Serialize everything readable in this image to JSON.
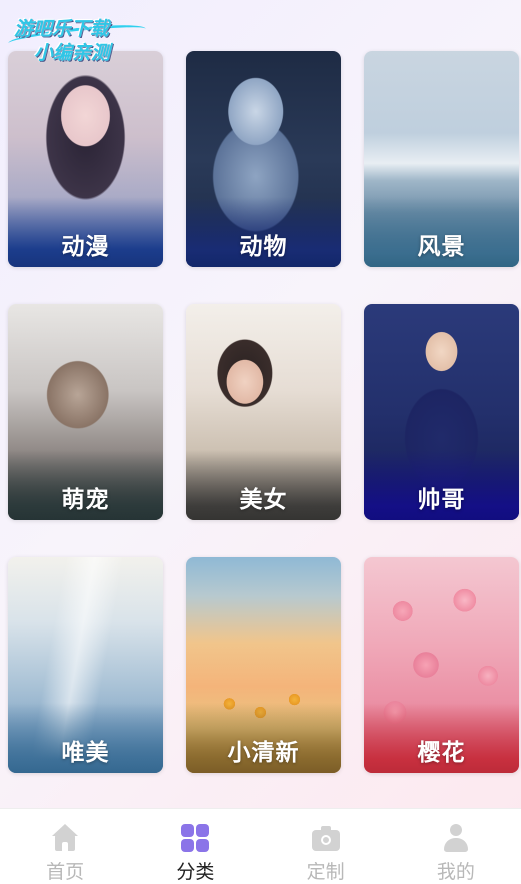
{
  "watermark": {
    "line1": "游吧乐下载",
    "line2": "小编亲测"
  },
  "categories": [
    {
      "label": "动漫",
      "icon": "anime-girl-image"
    },
    {
      "label": "动物",
      "icon": "white-fox-image"
    },
    {
      "label": "风景",
      "icon": "snow-mountain-lake-image"
    },
    {
      "label": "萌宠",
      "icon": "siamese-cat-image"
    },
    {
      "label": "美女",
      "icon": "girl-portrait-image"
    },
    {
      "label": "帅哥",
      "icon": "boy-portrait-image"
    },
    {
      "label": "唯美",
      "icon": "frozen-trees-image"
    },
    {
      "label": "小清新",
      "icon": "flower-field-image"
    },
    {
      "label": "樱花",
      "icon": "cherry-blossom-image"
    }
  ],
  "tabbar": {
    "active": "分类",
    "items": [
      {
        "label": "首页",
        "icon": "home-icon"
      },
      {
        "label": "分类",
        "icon": "category-grid-icon"
      },
      {
        "label": "定制",
        "icon": "camera-icon"
      },
      {
        "label": "我的",
        "icon": "profile-icon"
      }
    ]
  },
  "colors": {
    "accent": "#8b74e8",
    "inactive_tab": "#b8b8b8",
    "active_tab_text": "#222222"
  }
}
